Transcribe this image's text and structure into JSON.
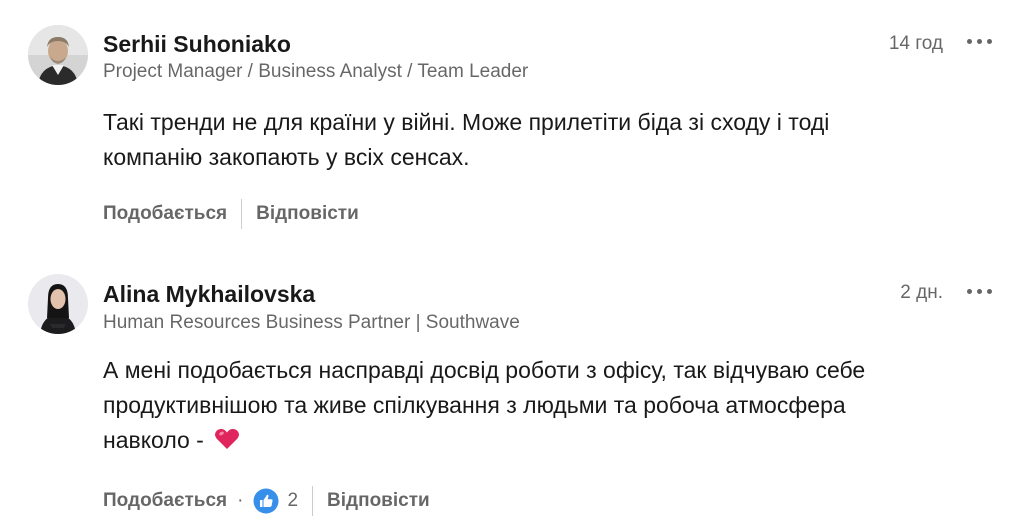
{
  "comments": [
    {
      "author": "Serhii Suhoniako",
      "headline": "Project Manager / Business Analyst / Team Leader",
      "time": "14 год",
      "body_lines": [
        "Такі тренди не для країни у війні. Може прилетіти біда зі сходу і тоді",
        "компанію закопають у всіх сенсах."
      ],
      "like_label": "Подобається",
      "reply_label": "Відповісти",
      "avatar_icon": "person-avatar-male"
    },
    {
      "author": "Alina Mykhailovska",
      "headline": "Human Resources Business Partner | Southwave",
      "time": "2 дн.",
      "body_lines": [
        "А мені подобається насправді досвід роботи з офісу, так відчуваю себе",
        "продуктивнішою та живе спілкування з людьми та робоча атмосфера",
        "навколо -"
      ],
      "emoji": "red-heart",
      "like_label": "Подобається",
      "reaction_separator": "·",
      "reaction_icon": "like-thumb-icon",
      "reaction_count": "2",
      "reply_label": "Відповісти",
      "avatar_icon": "person-avatar-female"
    }
  ],
  "colors": {
    "text_primary": "#191919",
    "text_secondary": "#666666",
    "like_blue": "#378fe9",
    "heart_red": "#e0245e"
  }
}
